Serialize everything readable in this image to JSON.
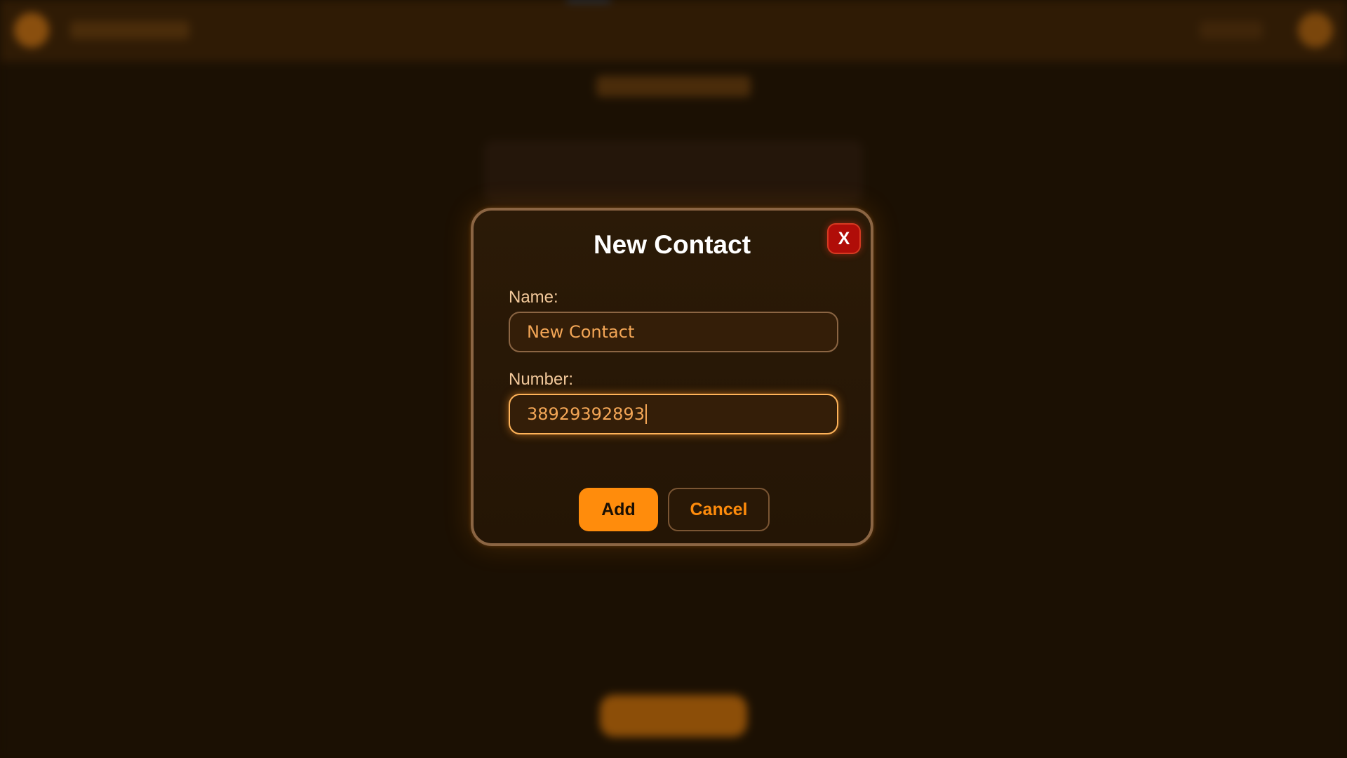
{
  "modal": {
    "title": "New Contact",
    "close_label": "X",
    "name_label": "Name:",
    "name_value": "New Contact",
    "number_label": "Number:",
    "number_value": "38929392893",
    "add_label": "Add",
    "cancel_label": "Cancel"
  },
  "colors": {
    "accent": "#ff8c0c",
    "close": "#b00d08",
    "modal_border": "#8b6543",
    "background": "#1a0f03"
  }
}
